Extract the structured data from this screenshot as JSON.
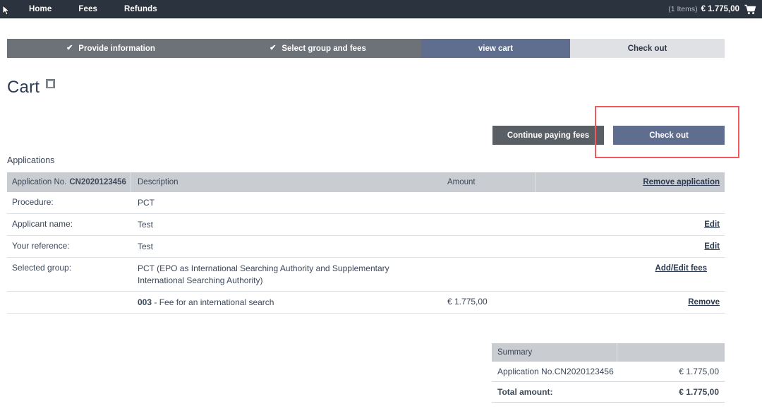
{
  "topnav": {
    "links": [
      {
        "label": "Home",
        "name": "nav-link-home"
      },
      {
        "label": "Fees",
        "name": "nav-link-fees"
      },
      {
        "label": "Refunds",
        "name": "nav-link-refunds"
      }
    ],
    "items_count": "(1 Items)",
    "total": "€ 1.775,00",
    "cart_icon": "shopping-cart-icon"
  },
  "stepper": {
    "steps": [
      {
        "label": "Provide information",
        "state": "done",
        "check": "✔"
      },
      {
        "label": "Select group and fees",
        "state": "done",
        "check": "✔"
      },
      {
        "label": "view cart",
        "state": "active",
        "check": ""
      },
      {
        "label": "Check out",
        "state": "next",
        "check": ""
      }
    ]
  },
  "page": {
    "title": "Cart",
    "help_icon": "help-icon",
    "help_glyph": "□"
  },
  "actions": {
    "continue_label": "Continue paying fees",
    "checkout_label": "Check out",
    "highlight_color": "#f4575c"
  },
  "applications": {
    "section_label": "Applications",
    "header": {
      "app_no_label": "Application No.",
      "app_no_value": "CN2020123456",
      "description": "Description",
      "amount": "Amount",
      "remove_application": "Remove application"
    },
    "rows": [
      {
        "label": "Procedure:",
        "value": "PCT",
        "amount": "",
        "action": ""
      },
      {
        "label": "Applicant name:",
        "value": "Test",
        "amount": "",
        "action": "Edit"
      },
      {
        "label": "Your reference:",
        "value": "Test",
        "amount": "",
        "action": "Edit"
      },
      {
        "label": "Selected group:",
        "value": "PCT (EPO as International Searching Authority and Supplementary International Searching Authority)",
        "amount": "",
        "action": "Add/Edit fees"
      }
    ],
    "fee_row": {
      "label": "",
      "code": "003",
      "description": " - Fee for an international search",
      "amount": "€ 1.775,00",
      "action": "Remove"
    }
  },
  "summary": {
    "header": "Summary",
    "rows": [
      {
        "label": "Application No.CN2020123456",
        "amount": "€ 1.775,00"
      }
    ],
    "total_label": "Total amount:",
    "total_amount": "€ 1.775,00"
  }
}
